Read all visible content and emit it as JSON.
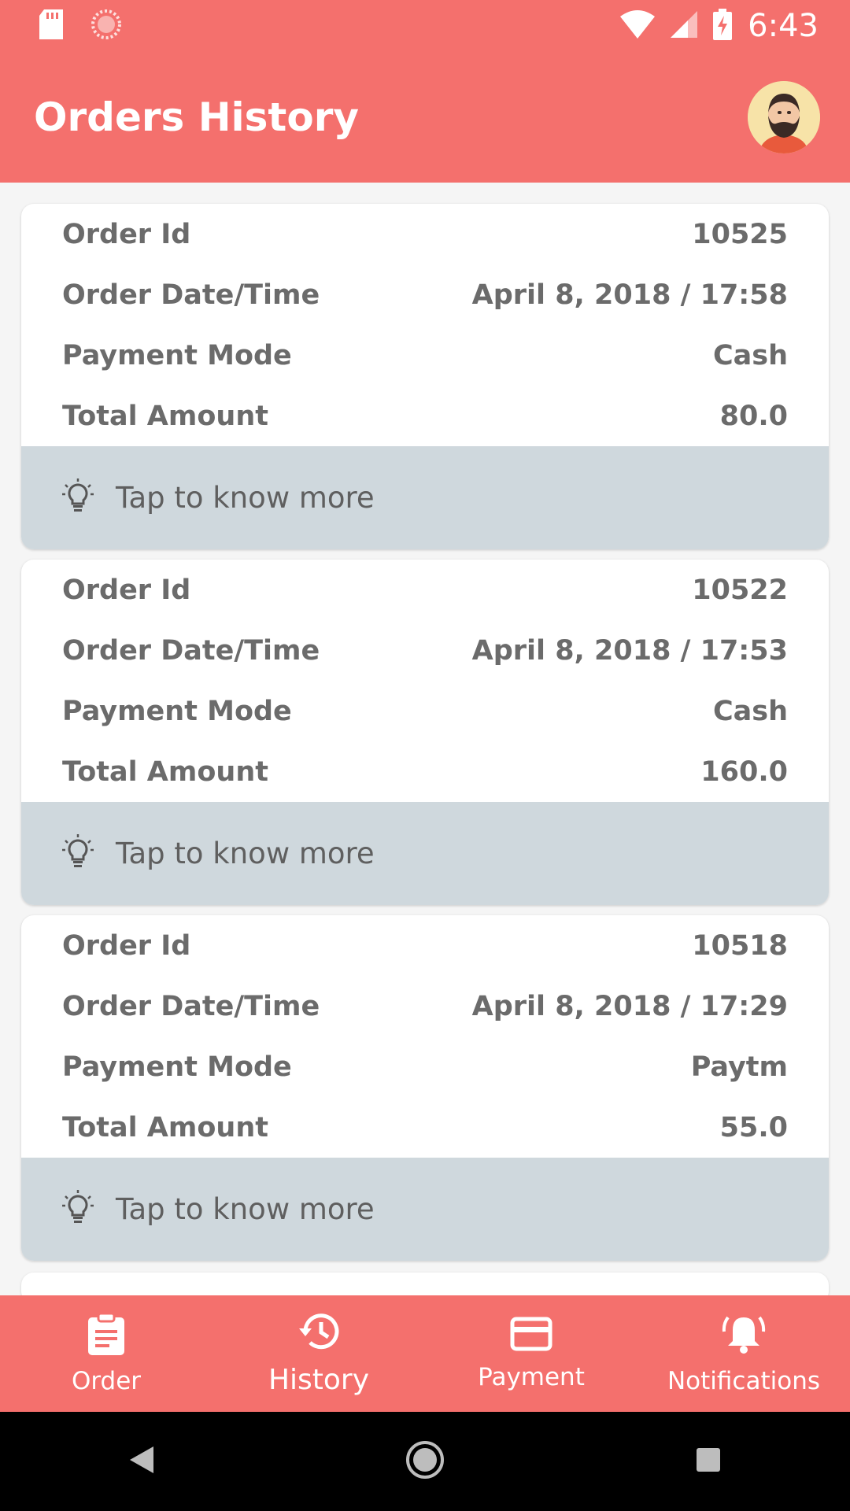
{
  "status_bar": {
    "time": "6:43"
  },
  "header": {
    "title": "Orders History"
  },
  "orders": [
    {
      "fields": [
        {
          "label": "Order Id",
          "value": "10525"
        },
        {
          "label": "Order Date/Time",
          "value": "April 8, 2018 / 17:58"
        },
        {
          "label": "Payment Mode",
          "value": "Cash"
        },
        {
          "label": "Total Amount",
          "value": "80.0"
        }
      ],
      "more_label": "Tap to know more"
    },
    {
      "fields": [
        {
          "label": "Order Id",
          "value": "10522"
        },
        {
          "label": "Order Date/Time",
          "value": "April 8, 2018 / 17:53"
        },
        {
          "label": "Payment Mode",
          "value": "Cash"
        },
        {
          "label": "Total Amount",
          "value": "160.0"
        }
      ],
      "more_label": "Tap to know more"
    },
    {
      "fields": [
        {
          "label": "Order Id",
          "value": "10518"
        },
        {
          "label": "Order Date/Time",
          "value": "April 8, 2018 / 17:29"
        },
        {
          "label": "Payment Mode",
          "value": "Paytm"
        },
        {
          "label": "Total Amount",
          "value": "55.0"
        }
      ],
      "more_label": "Tap to know more"
    }
  ],
  "bottom_nav": {
    "items": [
      {
        "label": "Order",
        "icon": "clipboard-icon"
      },
      {
        "label": "History",
        "icon": "history-icon",
        "active": true
      },
      {
        "label": "Payment",
        "icon": "credit-card-icon"
      },
      {
        "label": "Notifications",
        "icon": "bell-icon"
      }
    ]
  },
  "colors": {
    "primary": "#f4706d",
    "card_footer": "#cfd8dd",
    "text_gray": "#6b6b6b"
  }
}
